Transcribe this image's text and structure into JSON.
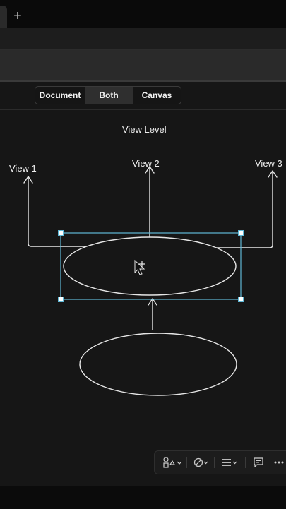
{
  "tabbar": {
    "new_tab_icon": "plus-icon",
    "new_tab_glyph": "+"
  },
  "view_switcher": {
    "options": [
      "Document",
      "Both",
      "Canvas"
    ],
    "selected": "Both"
  },
  "diagram": {
    "title": "View Level",
    "view1": "View 1",
    "view2": "View 2",
    "view3": "View 3"
  },
  "canvas_toolbar": {
    "icons": [
      "shapes-icon",
      "connector-style-icon",
      "stroke-lines-icon",
      "comment-icon",
      "more-icon"
    ]
  },
  "colors": {
    "background": "#161616",
    "stroke": "#e6e6e6",
    "selection": "#5fb8d6"
  }
}
